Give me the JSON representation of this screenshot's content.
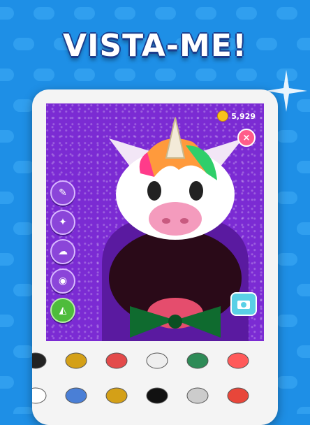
{
  "headline": "VISTA-ME!",
  "coins": "5,929",
  "close_label": "×",
  "colors": {
    "background": "#1e8fe6",
    "screen": "#7b2bd3",
    "coin": "#f8c21c",
    "close": "#ff5c8a"
  },
  "side_tools": [
    {
      "name": "paint-brush-icon"
    },
    {
      "name": "stars-icon"
    },
    {
      "name": "drip-icon"
    },
    {
      "name": "eyes-icon"
    },
    {
      "name": "mask-icon",
      "active": true
    }
  ],
  "tray_row1": [
    {
      "name": "black-bow-icon"
    },
    {
      "name": "laurel-medal-icon"
    },
    {
      "name": "3d-glasses-icon"
    },
    {
      "name": "cat-face-icon"
    },
    {
      "name": "bell-collar-icon"
    },
    {
      "name": "red-glasses-icon"
    }
  ],
  "tray_row2": [
    {
      "name": "flower-icon"
    },
    {
      "name": "butterfly-mask-icon"
    },
    {
      "name": "gold-bowtie-icon"
    },
    {
      "name": "round-glasses-icon"
    },
    {
      "name": "mouse-face-icon"
    },
    {
      "name": "antenna-icon"
    }
  ]
}
